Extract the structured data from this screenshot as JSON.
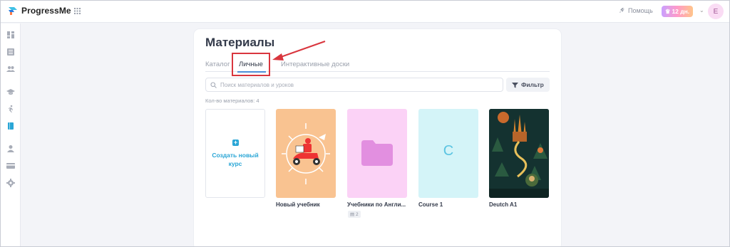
{
  "app": {
    "name": "ProgressMe"
  },
  "header": {
    "help_label": "Помощь",
    "badge_label": "12 дн.",
    "avatar_initial": "E"
  },
  "page": {
    "title": "Материалы"
  },
  "tabs": [
    {
      "label": "Каталог",
      "active": false
    },
    {
      "label": "Личные",
      "active": true
    },
    {
      "label": "Интерактивные доски",
      "active": false
    }
  ],
  "search": {
    "placeholder": "Поиск материалов и уроков"
  },
  "filter": {
    "label": "Фильтр"
  },
  "materials": {
    "count_label": "Кол-во материалов: 4",
    "create_label_line1": "Создать новый",
    "create_label_line2": "курс",
    "items": [
      {
        "title": "Новый учебник",
        "cover": "scooter-illustration",
        "color": "#f9c391"
      },
      {
        "title": "Учебники по Англи...",
        "cover": "folder-icon",
        "color": "#fbd2f6",
        "sub_count": "2"
      },
      {
        "title": "Course 1",
        "cover": "letter",
        "letter": "C",
        "color": "#d4f4f8"
      },
      {
        "title": "Deutch A1",
        "cover": "fantasy-illustration",
        "color": "#1a3a35"
      }
    ]
  },
  "colors": {
    "accent": "#2aa6d6",
    "tab_active_underline": "#4d8ed8",
    "highlight": "#d9363e"
  }
}
